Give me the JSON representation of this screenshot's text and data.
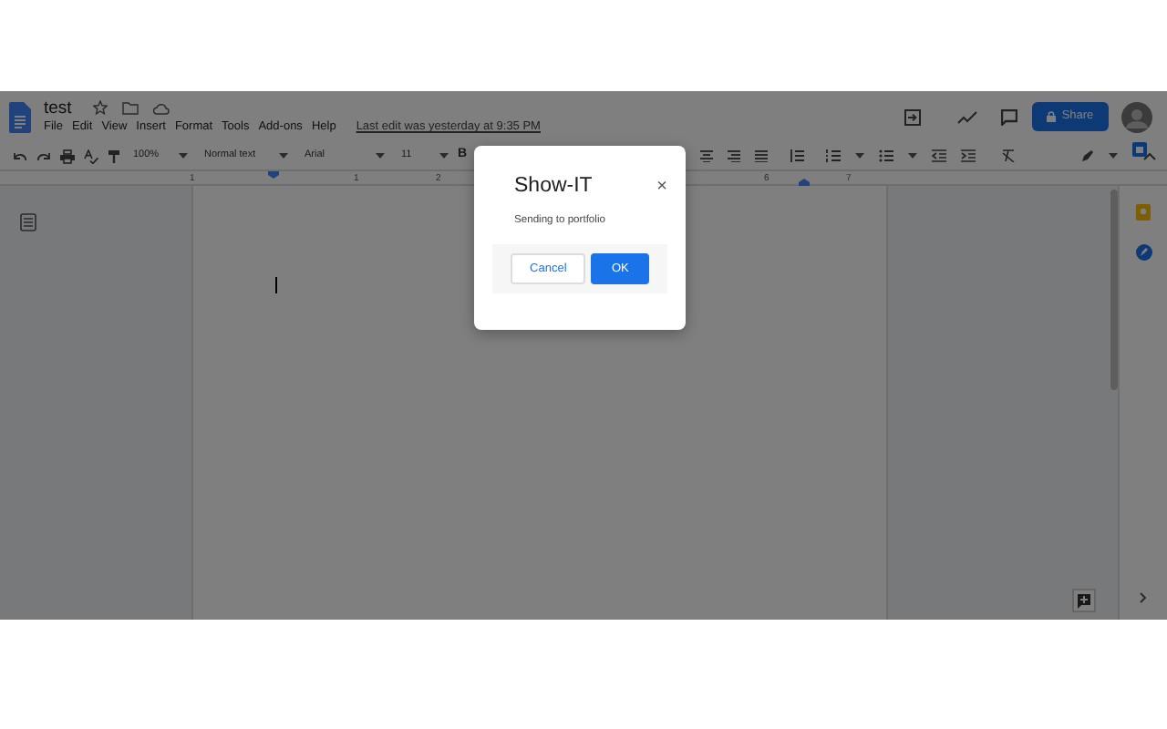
{
  "header": {
    "doc_title": "test",
    "menu": [
      "File",
      "Edit",
      "View",
      "Insert",
      "Format",
      "Tools",
      "Add-ons",
      "Help"
    ],
    "last_edit": "Last edit was yesterday at 9:35 PM",
    "share_button": "Share"
  },
  "toolbar": {
    "zoom": "100%",
    "style": "Normal text",
    "font": "Arial",
    "font_size": "11",
    "bold_label": "B"
  },
  "ruler": {
    "labels": [
      "1",
      "1",
      "2",
      "6",
      "7"
    ]
  },
  "dialog": {
    "title": "Show-IT",
    "close": "×",
    "message": "Sending to portfolio",
    "buttons": [
      {
        "label": "Cancel",
        "kind": "secondary"
      },
      {
        "label": "OK",
        "kind": "primary"
      }
    ]
  }
}
